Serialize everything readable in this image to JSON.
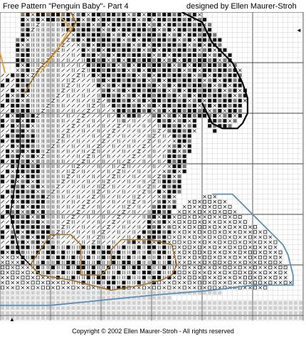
{
  "header": {
    "title": "Free Pattern \"Penguin Baby\"-  Part 4",
    "author": "designed by Ellen Maurer-Stroh"
  },
  "markers": {
    "center_bottom": "▲",
    "center_right": "◄"
  },
  "footer": {
    "copyright": "Copyright © 2002 Ellen Maurer-Stroh  - All rights reserved"
  },
  "colors": {
    "grid_minor": "#c8c8c8",
    "grid_major": "#444444",
    "black_fill": "#111111",
    "mid_gray": "#777777",
    "light_gray": "#cfcfcf",
    "backstitch_black": "#000000",
    "backstitch_brown": "#a0702a",
    "backstitch_blue": "#5a8fb5",
    "backstitch_orange": "#e8a13a"
  },
  "symbols": {
    "dark": "■",
    "medium": "◆",
    "slash": "/",
    "diagonal_cross": "✕",
    "z_stitch": "Z",
    "bars": "||",
    "small_square": "□"
  }
}
